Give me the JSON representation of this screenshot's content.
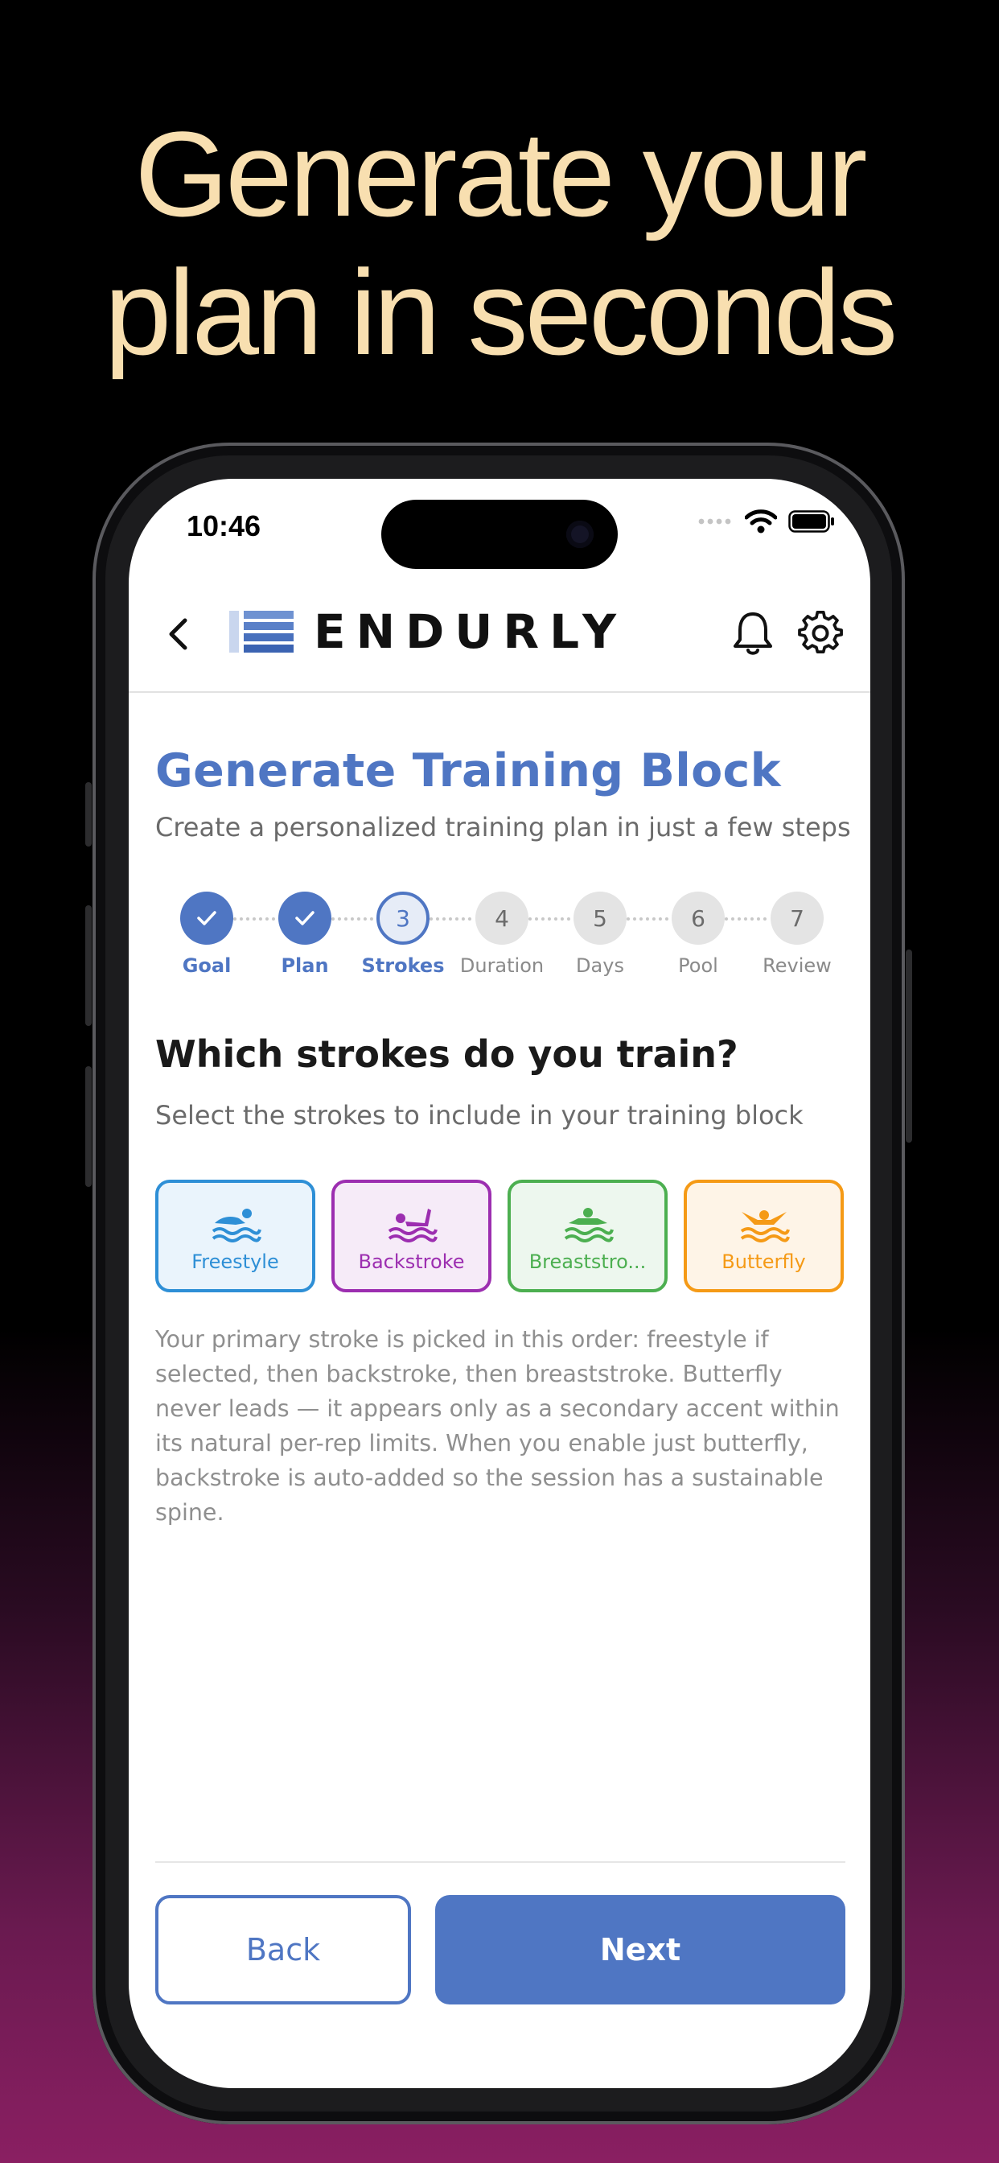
{
  "headline": {
    "line1": "Generate your",
    "line2": "plan in seconds"
  },
  "status_bar": {
    "time": "10:46"
  },
  "header": {
    "brand": "ENDURLY",
    "back_icon": "chevron-left-icon",
    "bell_icon": "bell-icon",
    "settings_icon": "gear-icon"
  },
  "page": {
    "title": "Generate Training Block",
    "subtitle": "Create a personalized training plan in just a few steps"
  },
  "stepper": {
    "current_step": 3,
    "steps": [
      {
        "number": "1",
        "label": "Goal",
        "state": "done"
      },
      {
        "number": "2",
        "label": "Plan",
        "state": "done"
      },
      {
        "number": "3",
        "label": "Strokes",
        "state": "active"
      },
      {
        "number": "4",
        "label": "Duration",
        "state": "todo"
      },
      {
        "number": "5",
        "label": "Days",
        "state": "todo"
      },
      {
        "number": "6",
        "label": "Pool",
        "state": "todo"
      },
      {
        "number": "7",
        "label": "Review",
        "state": "todo"
      }
    ]
  },
  "question": {
    "title": "Which strokes do you train?",
    "subtitle": "Select the strokes to include in your training block"
  },
  "strokes": [
    {
      "label": "Freestyle",
      "icon": "freestyle-swimmer-icon",
      "color": "#2e8fd6",
      "bg": "#eaf4fc"
    },
    {
      "label": "Backstroke",
      "icon": "backstroke-swimmer-icon",
      "color": "#9c2eb0",
      "bg": "#f6ebf8"
    },
    {
      "label": "Breaststro...",
      "icon": "breaststroke-swimmer-icon",
      "color": "#4caf50",
      "bg": "#edf7ee"
    },
    {
      "label": "Butterfly",
      "icon": "butterfly-swimmer-icon",
      "color": "#f59a16",
      "bg": "#fef4e7"
    }
  ],
  "note": "Your primary stroke is picked in this order: freestyle if selected, then backstroke, then breaststroke. Butterfly never leads — it appears only as a secondary accent within its natural per-rep limits. When you enable just butterfly, backstroke is auto-added so the session has a sustainable spine.",
  "buttons": {
    "back": "Back",
    "next": "Next"
  },
  "colors": {
    "accent": "#4f76c3",
    "headline": "#f8dfb0"
  }
}
